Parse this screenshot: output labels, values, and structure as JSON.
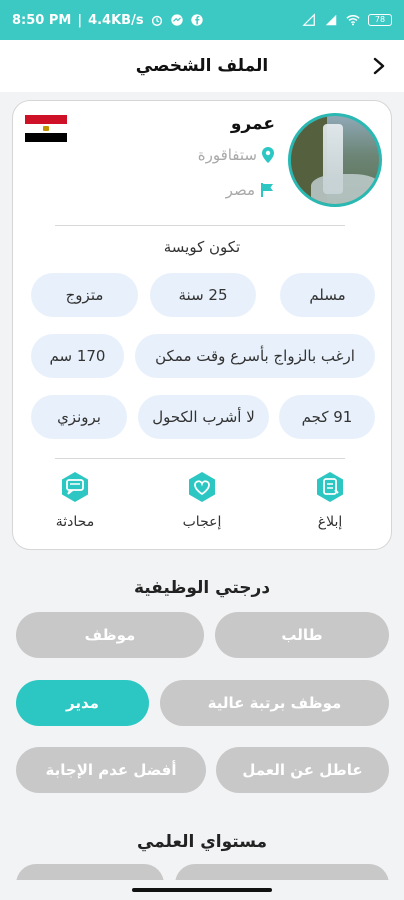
{
  "status": {
    "time": "8:50 PM",
    "network_speed": "4.4KB/s",
    "battery": "78"
  },
  "header": {
    "title": "الملف الشخصي"
  },
  "profile": {
    "name": "عمرو",
    "city": "ستفاقورة",
    "country": "مصر",
    "about": "تكون كويسة",
    "chips_row1": [
      "مسلم",
      "25 سنة",
      "متزوج"
    ],
    "chips_row2": [
      "ارغب بالزواج بأسرع وقت ممكن",
      "170 سم"
    ],
    "chips_row3": [
      "91 كجم",
      "لا أشرب الكحول",
      "برونزي"
    ],
    "actions": {
      "report": "إبلاغ",
      "like": "إعجاب",
      "chat": "محادثة"
    }
  },
  "job_section": {
    "title": "درجتي الوظيفية",
    "options": [
      "طالب",
      "موظف",
      "موظف برتبة عالية",
      "مدير",
      "عاطل عن العمل",
      "أفضل عدم الإجابة"
    ],
    "selected": "مدير"
  },
  "education_section": {
    "title": "مستواي العلمي"
  },
  "colors": {
    "accent": "#2cc7c2",
    "status_bar": "#3cc8c3",
    "chip_bg": "#e8f1fb",
    "pill_inactive": "#c8c8c8"
  }
}
